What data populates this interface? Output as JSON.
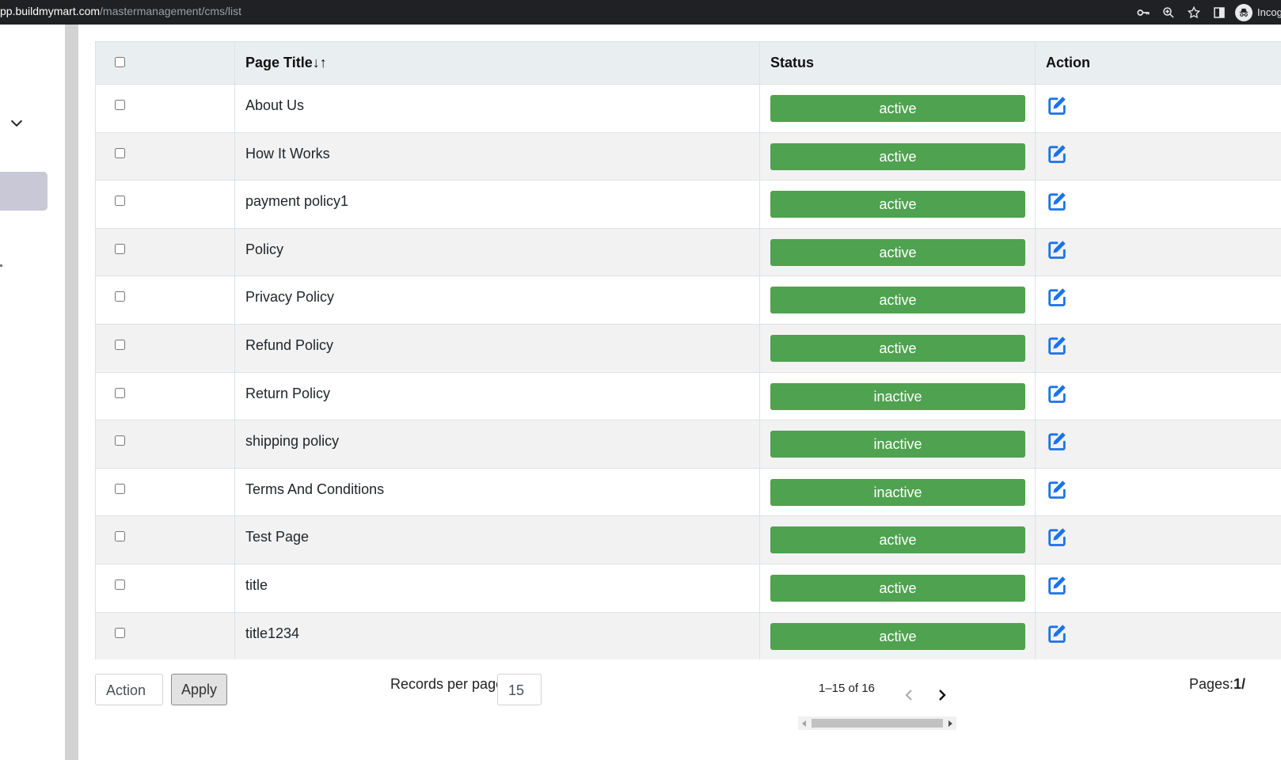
{
  "browser": {
    "url_domain": "pp.buildmymart.com",
    "url_path": "/mastermanagement/cms/list",
    "profile_label": "Incognito"
  },
  "table": {
    "headers": {
      "title": "Page Title",
      "sort_arrows": "↓↑",
      "status": "Status",
      "action": "Action"
    },
    "rows": [
      {
        "title": "About Us",
        "status": "active"
      },
      {
        "title": "How It Works",
        "status": "active"
      },
      {
        "title": "payment policy1",
        "status": "active"
      },
      {
        "title": "Policy",
        "status": "active"
      },
      {
        "title": "Privacy Policy",
        "status": "active"
      },
      {
        "title": "Refund Policy",
        "status": "active"
      },
      {
        "title": "Return Policy",
        "status": "inactive"
      },
      {
        "title": "shipping policy",
        "status": "inactive"
      },
      {
        "title": "Terms And Conditions",
        "status": "inactive"
      },
      {
        "title": "Test Page",
        "status": "active"
      },
      {
        "title": "title",
        "status": "active"
      },
      {
        "title": "title1234",
        "status": "active"
      }
    ]
  },
  "footer": {
    "action_select": "Action",
    "apply_label": "Apply",
    "records_label": "Records per page:",
    "records_value": "15",
    "range_text": "1–15 of 16",
    "pages_label": "Pages:",
    "pages_current": "1/"
  },
  "colors": {
    "badge_green": "#4fa24f",
    "edit_blue": "#1a73e8",
    "header_bg": "#e9eef1",
    "browser_bar": "#202124"
  },
  "icons": {
    "key": "key-icon",
    "zoom": "zoom-icon",
    "star": "star-icon",
    "sidepanel": "side-panel-icon",
    "incognito": "incognito-icon",
    "edit": "edit-icon",
    "chevron": "chevron-down-icon"
  }
}
